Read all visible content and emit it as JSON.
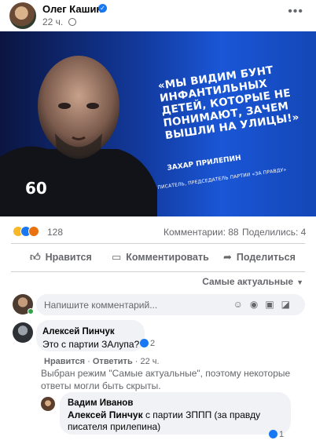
{
  "post": {
    "author": "Олег Кашин",
    "time": "22 ч.",
    "image": {
      "quote": "«МЫ ВИДИМ БУНТ ИНФАНТИЛЬНЫХ ДЕТЕЙ, КОТОРЫЕ НЕ ПОНИМАЮТ, ЗАЧЕМ ВЫШЛИ НА УЛИЦЫ!»",
      "speaker": "ЗАХАР ПРИЛЕПИН",
      "speaker_title": "ПИСАТЕЛЬ, ПРЕДСЕДАТЕЛЬ ПАРТИИ «ЗА ПРАВДУ»",
      "channel": "60"
    },
    "reactions_count": "128",
    "comments_count": "Комментарии: 88",
    "shares_count": "Поделились: 4"
  },
  "actions": {
    "like": "Нравится",
    "comment": "Комментировать",
    "share": "Поделиться"
  },
  "sort": {
    "label": "Самые актуальные"
  },
  "comment_input": {
    "placeholder": "Напишите комментарий..."
  },
  "comments": [
    {
      "author": "Алексей Пинчук",
      "text": "Это с партии ЗАлупа?",
      "likes": "2",
      "actions": {
        "like": "Нравится",
        "reply": "Ответить",
        "time": "22 ч."
      },
      "note": "Выбран режим \"Самые актуальные\", поэтому некоторые ответы могли быть скрыты."
    },
    {
      "author": "Вадим Иванов",
      "mention": "Алексей Пинчук",
      "text": " с партии ЗППП (за правду писателя прилепина)",
      "likes": "1"
    }
  ],
  "colors": {
    "accent": "#1877f2",
    "muted": "#65676b",
    "bubble": "#f0f2f5"
  }
}
